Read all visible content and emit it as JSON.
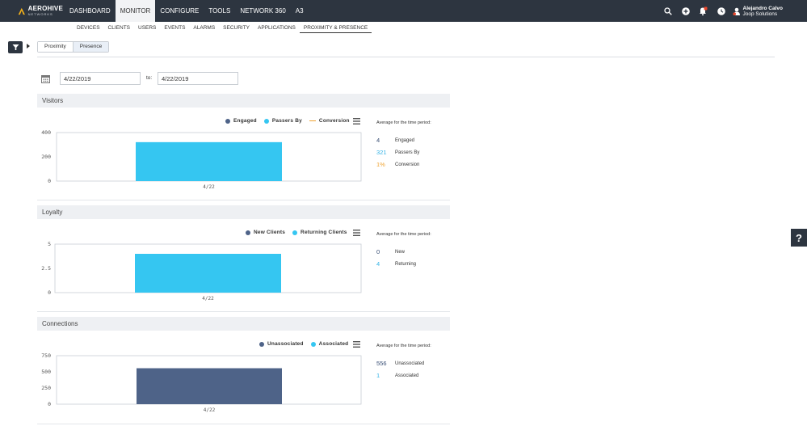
{
  "app": {
    "logo_text": "AEROHIVE",
    "logo_sub": "NETWORKS"
  },
  "topnav": [
    {
      "label": "DASHBOARD",
      "active": false
    },
    {
      "label": "MONITOR",
      "active": true
    },
    {
      "label": "CONFIGURE",
      "active": false
    },
    {
      "label": "TOOLS",
      "active": false
    },
    {
      "label": "NETWORK 360",
      "active": false
    },
    {
      "label": "A3",
      "active": false
    }
  ],
  "user": {
    "name": "Alejandro Calvo",
    "org": "Joop Solutions"
  },
  "subnav": [
    {
      "label": "DEVICES",
      "active": false
    },
    {
      "label": "CLIENTS",
      "active": false
    },
    {
      "label": "USERS",
      "active": false
    },
    {
      "label": "EVENTS",
      "active": false
    },
    {
      "label": "ALARMS",
      "active": false
    },
    {
      "label": "SECURITY",
      "active": false
    },
    {
      "label": "APPLICATIONS",
      "active": false
    },
    {
      "label": "PROXIMITY & PRESENCE",
      "active": true
    }
  ],
  "ptabs": {
    "proximity": "Proximity",
    "presence": "Presence"
  },
  "dates": {
    "from": "4/22/2019",
    "to_label": "to:",
    "to": "4/22/2019"
  },
  "avg_title": "Average for the time period:",
  "colors": {
    "engaged": "#4e6388",
    "passers": "#35c6f1",
    "conversion": "#f0a433",
    "bar_cyan": "#35c6f1",
    "bar_navy": "#4e6388",
    "topbar": "#2d3540"
  },
  "panels": {
    "visitors": {
      "title": "Visitors",
      "stats": [
        {
          "value": "4",
          "label": "Engaged",
          "color": "#3a4f75"
        },
        {
          "value": "321",
          "label": "Passers By",
          "color": "#35b3e6"
        },
        {
          "value": "1%",
          "label": "Conversion",
          "color": "#f0a433"
        }
      ]
    },
    "loyalty": {
      "title": "Loyalty",
      "stats": [
        {
          "value": "0",
          "label": "New",
          "color": "#3a4f75"
        },
        {
          "value": "4",
          "label": "Returning",
          "color": "#35b3e6"
        }
      ]
    },
    "connections": {
      "title": "Connections",
      "stats": [
        {
          "value": "556",
          "label": "Unassociated",
          "color": "#3a4f75"
        },
        {
          "value": "1",
          "label": "Associated",
          "color": "#35b3e6"
        }
      ]
    }
  },
  "chart_data": [
    {
      "type": "bar",
      "title": "",
      "categories": [
        "4/22"
      ],
      "series": [
        {
          "name": "Engaged",
          "values": [
            4
          ]
        },
        {
          "name": "Passers By",
          "values": [
            321
          ]
        },
        {
          "name": "Conversion",
          "values": [
            1
          ]
        }
      ],
      "ylim": [
        0,
        400
      ],
      "yticks": [
        0,
        200,
        400
      ],
      "legend": "top-right"
    },
    {
      "type": "bar",
      "title": "",
      "categories": [
        "4/22"
      ],
      "series": [
        {
          "name": "New Clients",
          "values": [
            0
          ]
        },
        {
          "name": "Returning Clients",
          "values": [
            4
          ]
        }
      ],
      "ylim": [
        0,
        5
      ],
      "yticks": [
        0,
        2.5,
        5
      ],
      "legend": "top-right"
    },
    {
      "type": "bar",
      "title": "",
      "categories": [
        "4/22"
      ],
      "series": [
        {
          "name": "Unassociated",
          "values": [
            556
          ]
        },
        {
          "name": "Associated",
          "values": [
            1
          ]
        }
      ],
      "ylim": [
        0,
        750
      ],
      "yticks": [
        0,
        250,
        500,
        750
      ],
      "legend": "top-right"
    }
  ]
}
